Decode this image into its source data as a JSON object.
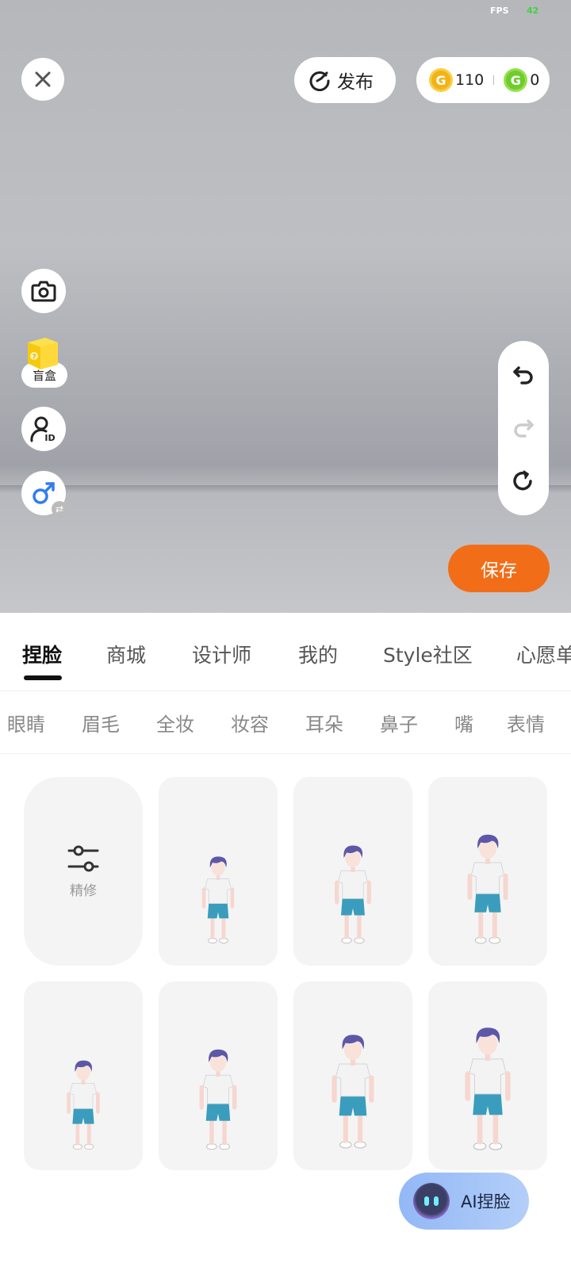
{
  "fps": {
    "label": "FPS",
    "value": "42"
  },
  "toolbar": {
    "publish_label": "发布",
    "coins": [
      {
        "icon": "gold-coin-icon",
        "value": "110"
      },
      {
        "icon": "green-coin-icon",
        "value": "0"
      }
    ]
  },
  "left_tools": {
    "blindbox_label": "盲盒"
  },
  "save_label": "保存",
  "tabs": [
    "捏脸",
    "商城",
    "设计师",
    "我的",
    "Style社区",
    "心愿单"
  ],
  "active_tab": "捏脸",
  "subtabs": [
    "眼睛",
    "眉毛",
    "全妆",
    "妆容",
    "耳朵",
    "鼻子",
    "嘴",
    "表情"
  ],
  "grid": {
    "fine_tune_label": "精修",
    "items": [
      {
        "name": "body-shape-1"
      },
      {
        "name": "body-shape-2"
      },
      {
        "name": "body-shape-3"
      },
      {
        "name": "body-shape-4"
      },
      {
        "name": "body-shape-5"
      },
      {
        "name": "body-shape-6"
      },
      {
        "name": "body-shape-7"
      }
    ]
  },
  "ai_button_label": "AI捏脸",
  "colors": {
    "accent": "#f26d18",
    "gold": "#f3b315",
    "green": "#6fcc2d",
    "hair": "#5d57a8",
    "shorts": "#3a9dbd"
  }
}
